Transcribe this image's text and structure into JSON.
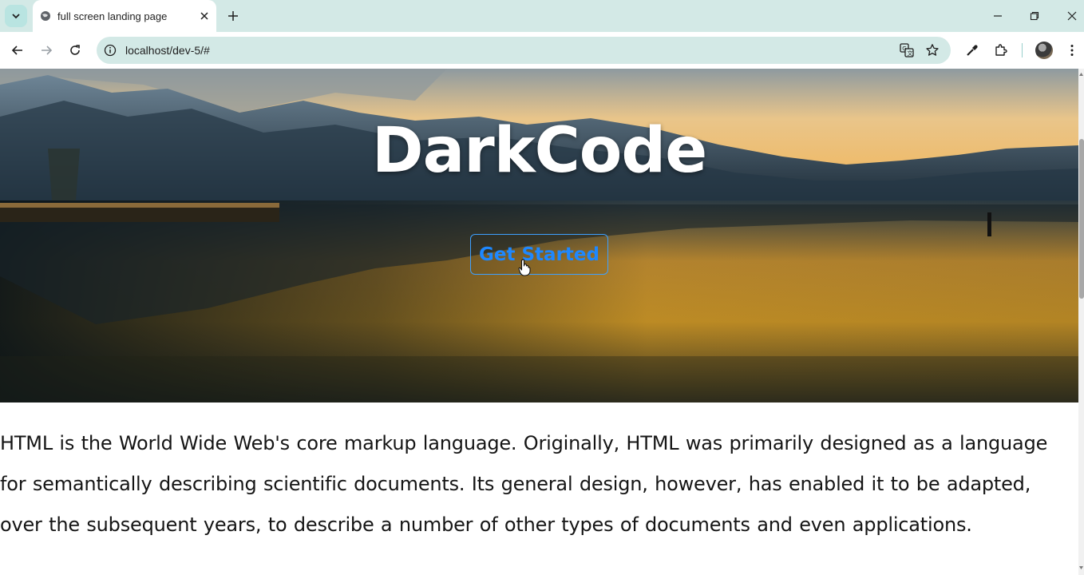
{
  "browser": {
    "tab_title": "full screen landing page",
    "url": "localhost/dev-5/#"
  },
  "page": {
    "hero_title": "DarkCode",
    "cta_label": "Get Started",
    "paragraph_lines": [
      "HTML is the World Wide Web's core markup language. Originally, HTML was primarily designed as a language",
      "for semantically describing scientific documents. Its general design, however, has enabled it to be adapted,",
      "over the subsequent years, to describe a number of other types of documents and even applications."
    ]
  },
  "colors": {
    "tab_strip": "#d3e9e6",
    "omnibox": "#d3e9e6",
    "cta_accent": "#1e88ff",
    "hero_sky": "#f2b85a",
    "hero_water": "#c98c22"
  }
}
